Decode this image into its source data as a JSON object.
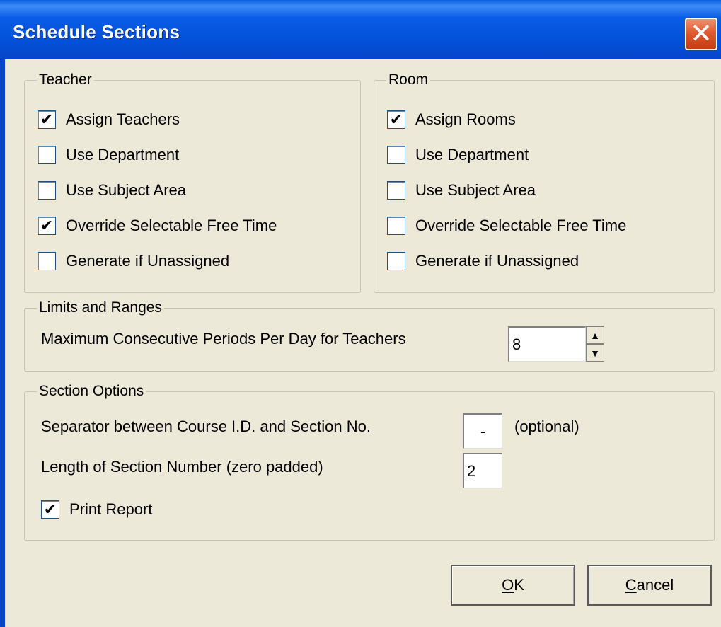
{
  "window": {
    "title": "Schedule Sections",
    "close_label": "✕"
  },
  "teacher": {
    "title": "Teacher",
    "options": [
      {
        "label": "Assign Teachers",
        "checked": true
      },
      {
        "label": "Use Department",
        "checked": false
      },
      {
        "label": "Use Subject Area",
        "checked": false
      },
      {
        "label": "Override Selectable Free Time",
        "checked": true
      },
      {
        "label": "Generate if Unassigned",
        "checked": false
      }
    ]
  },
  "room": {
    "title": "Room",
    "options": [
      {
        "label": "Assign Rooms",
        "checked": true
      },
      {
        "label": "Use Department",
        "checked": false
      },
      {
        "label": "Use Subject Area",
        "checked": false
      },
      {
        "label": "Override Selectable Free Time",
        "checked": false
      },
      {
        "label": "Generate if Unassigned",
        "checked": false
      }
    ]
  },
  "limits": {
    "title": "Limits and Ranges",
    "max_consecutive_label": "Maximum Consecutive Periods Per Day for Teachers",
    "max_consecutive_value": "8",
    "spin_up": "▲",
    "spin_down": "▼"
  },
  "section_options": {
    "title": "Section Options",
    "separator_label": "Separator between Course I.D. and Section No.",
    "separator_value": "-",
    "separator_hint": "(optional)",
    "length_label": "Length of Section Number  (zero padded)",
    "length_value": "2",
    "print_report_label": "Print Report",
    "print_report_checked": true
  },
  "buttons": {
    "ok_mnemonic": "O",
    "ok_rest": "K",
    "cancel_mnemonic": "C",
    "cancel_rest": "ancel"
  },
  "colors": {
    "titlebar": "#0350d8",
    "face": "#ece9d8",
    "close": "#e05b32"
  }
}
